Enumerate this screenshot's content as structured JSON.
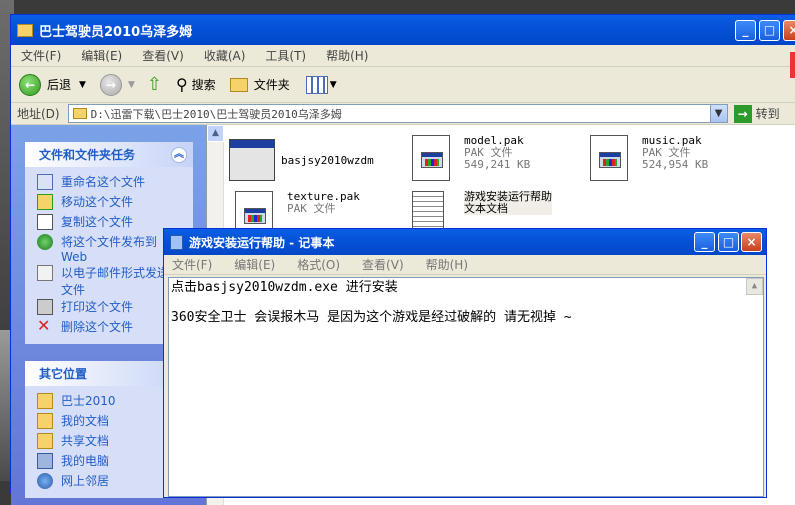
{
  "explorer": {
    "title": "巴士驾驶员2010乌泽多姆",
    "menu": [
      "文件(F)",
      "编辑(E)",
      "查看(V)",
      "收藏(A)",
      "工具(T)",
      "帮助(H)"
    ],
    "toolbar": {
      "back": "后退",
      "search": "搜索",
      "folders": "文件夹"
    },
    "address": {
      "label": "地址(D)",
      "value": "D:\\迅雷下载\\巴士2010\\巴士驾驶员2010乌泽多姆",
      "go": "转到"
    },
    "tasks": {
      "title": "文件和文件夹任务",
      "items": [
        {
          "label": "重命名这个文件",
          "icon": "rename-icon"
        },
        {
          "label": "移动这个文件",
          "icon": "move-icon"
        },
        {
          "label": "复制这个文件",
          "icon": "copy-icon"
        },
        {
          "label": "将这个文件发布到 Web",
          "icon": "publish-web-icon"
        },
        {
          "label": "以电子邮件形式发送此文件",
          "icon": "email-icon"
        },
        {
          "label": "打印这个文件",
          "icon": "print-icon"
        },
        {
          "label": "删除这个文件",
          "icon": "delete-icon"
        }
      ]
    },
    "places": {
      "title": "其它位置",
      "items": [
        {
          "label": "巴士2010",
          "icon": "folder-icon"
        },
        {
          "label": "我的文档",
          "icon": "my-documents-icon"
        },
        {
          "label": "共享文档",
          "icon": "shared-documents-icon"
        },
        {
          "label": "我的电脑",
          "icon": "my-computer-icon"
        },
        {
          "label": "网上邻居",
          "icon": "network-icon"
        }
      ]
    },
    "files": [
      {
        "name": "basjsy2010wzdm",
        "type": "",
        "size": "",
        "icon": "exe-icon"
      },
      {
        "name": "model.pak",
        "type": "PAK 文件",
        "size": "549,241 KB",
        "icon": "pak-file-icon"
      },
      {
        "name": "music.pak",
        "type": "PAK 文件",
        "size": "524,954 KB",
        "icon": "pak-file-icon"
      },
      {
        "name": "texture.pak",
        "type": "PAK 文件",
        "size": "",
        "icon": "pak-file-icon"
      },
      {
        "name": "游戏安装运行帮助",
        "type": "文本文档",
        "size": "",
        "icon": "text-file-icon"
      }
    ]
  },
  "notepad": {
    "title": "游戏安装运行帮助 - 记事本",
    "menu": [
      "文件(F)",
      "编辑(E)",
      "格式(O)",
      "查看(V)",
      "帮助(H)"
    ],
    "lines": [
      "点击basjsy2010wzdm.exe 进行安装",
      "360安全卫士 会误报木马 是因为这个游戏是经过破解的 请无视掉 ~"
    ]
  },
  "colors": {
    "titlebar": "#0553d8",
    "taskpane": "#6375d6",
    "link": "#215dc6"
  }
}
